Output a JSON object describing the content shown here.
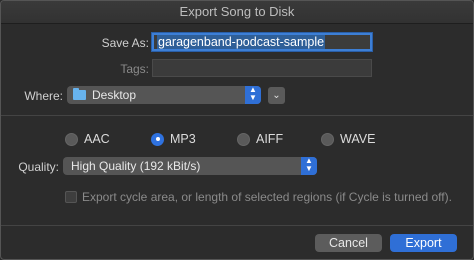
{
  "window": {
    "title": "Export Song to Disk"
  },
  "save_as": {
    "label": "Save As:",
    "value": "garagenband-podcast-sample"
  },
  "tags": {
    "label": "Tags:",
    "value": ""
  },
  "where": {
    "label": "Where:",
    "value": "Desktop",
    "folder_icon": "folder-icon",
    "expand_icon": "chevron-down-icon"
  },
  "format": {
    "options": [
      "AAC",
      "MP3",
      "AIFF",
      "WAVE"
    ],
    "selected": "MP3"
  },
  "quality": {
    "label": "Quality:",
    "value": "High Quality (192 kBit/s)"
  },
  "cycle_option": {
    "label": "Export cycle area, or length of selected regions (if Cycle is turned off).",
    "checked": false,
    "enabled": false
  },
  "buttons": {
    "cancel": "Cancel",
    "export": "Export"
  },
  "colors": {
    "accent": "#2f6fd6",
    "background": "#2c2c2c",
    "folder": "#67b3ee"
  }
}
